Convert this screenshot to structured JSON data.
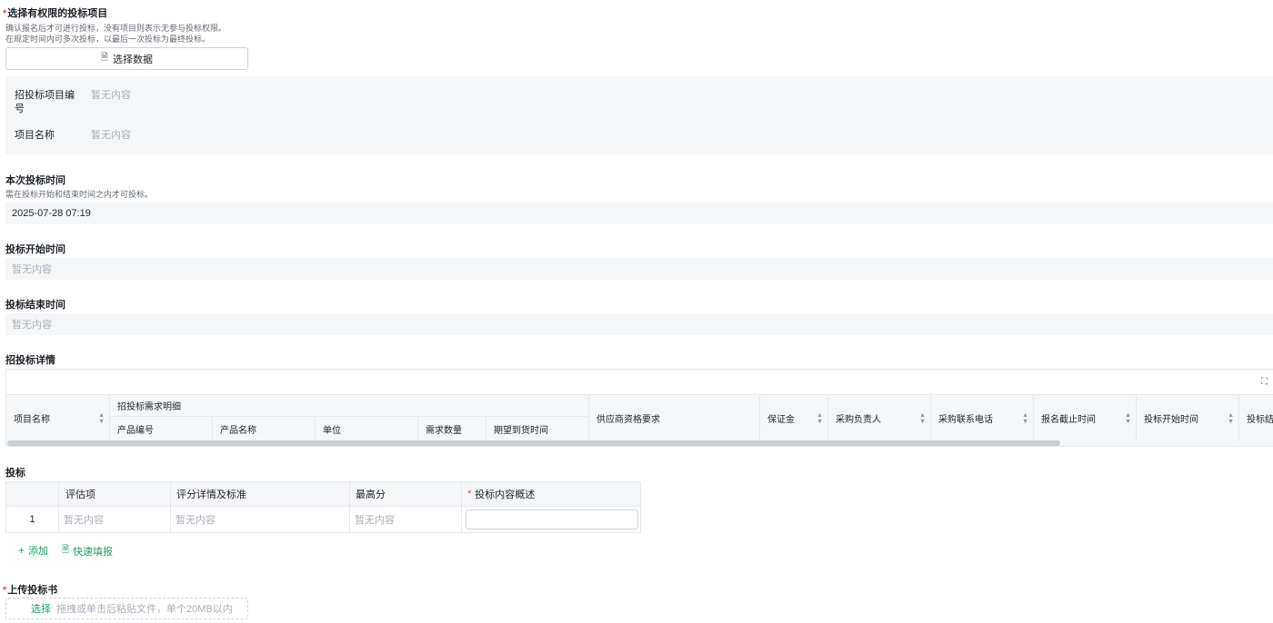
{
  "project_select": {
    "title": "选择有权限的投标项目",
    "hint_line1": "确认报名后才可进行投标，没有项目则表示无参与投标权限。",
    "hint_line2": "在规定时间内可多次投标，以最后一次投标为最终投标。",
    "button_label": "选择数据",
    "button_icon": "document-icon"
  },
  "project_info": {
    "code_label": "招投标项目编\n号",
    "code_value": "暂无内容",
    "name_label": "项目名称",
    "name_value": "暂无内容"
  },
  "bid_time": {
    "title": "本次投标时间",
    "hint": "需在投标开始和结束时间之内才可投标。",
    "value": "2025-07-28 07:19"
  },
  "bid_start": {
    "title": "投标开始时间",
    "value": "暂无内容"
  },
  "bid_end": {
    "title": "投标结束时间",
    "value": "暂无内容"
  },
  "detail": {
    "title": "招投标详情",
    "expand_icon": "expand-icon",
    "columns": {
      "project_name": "项目名称",
      "group": "招投标需求明细",
      "product_code": "产品编号",
      "product_name": "产品名称",
      "unit": "单位",
      "quantity": "需求数量",
      "delivery_time": "期望到货时间",
      "qualification": "供应商资格要求",
      "deposit": "保证金",
      "buyer": "采购负责人",
      "buyer_phone": "采购联系电话",
      "signup_deadline": "报名截止时间",
      "bid_start": "投标开始时间",
      "bid_end": "投标结"
    }
  },
  "bid": {
    "title": "投标",
    "columns": {
      "item": "评估项",
      "criteria": "评分详情及标准",
      "max_score": "最高分",
      "summary": "投标内容概述"
    },
    "rows": [
      {
        "index": "1",
        "item": "暂无内容",
        "criteria": "暂无内容",
        "max_score": "暂无内容",
        "summary": ""
      }
    ],
    "add_label": "添加",
    "quick_label": "快速填报"
  },
  "upload": {
    "title": "上传投标书",
    "select_label": "选择",
    "tip": "拖拽或单击后粘贴文件，单个20MB以内"
  },
  "colors": {
    "accent": "#1aa16a",
    "required": "#f54a45",
    "placeholder": "#a9aeb8",
    "field_bg": "#f5f6f7"
  }
}
